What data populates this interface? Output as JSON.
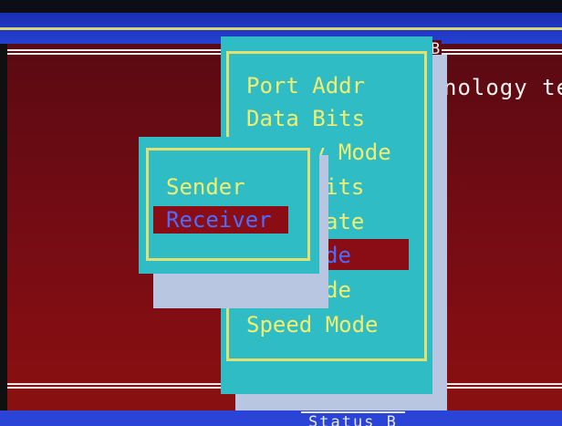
{
  "header": {
    "title_fragment": "B"
  },
  "background": {
    "text": "nology tes"
  },
  "menu": {
    "items": [
      {
        "label": "Port Addr"
      },
      {
        "label": "Data Bits"
      },
      {
        "label": "y Mode"
      },
      {
        "label": "its"
      },
      {
        "label": "ate"
      },
      {
        "label": "de",
        "selected": true
      },
      {
        "label": "de"
      },
      {
        "label": "Speed Mode"
      }
    ]
  },
  "submenu": {
    "items": [
      {
        "label": "Sender"
      },
      {
        "label": "Receiver",
        "selected": true
      }
    ]
  },
  "status": {
    "label": "Status B"
  },
  "colors": {
    "menu_bg": "#30bcc4",
    "menu_text": "#f0ee70",
    "selected_bg": "#8a0c14",
    "selected_text": "#4c6cff",
    "screen_red": "#7a0c14",
    "screen_blue": "#2540d0"
  }
}
